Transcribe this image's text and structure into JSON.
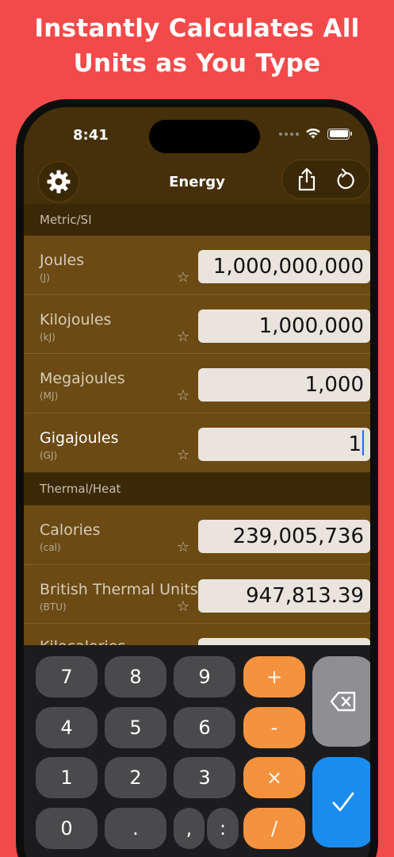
{
  "promo": {
    "line1": "Instantly Calculates All",
    "line2": "Units as You Type"
  },
  "status": {
    "time": "8:41"
  },
  "nav": {
    "title": "Energy",
    "icons": [
      "gear-icon",
      "share-icon",
      "reset-icon"
    ]
  },
  "sections": [
    {
      "title": "Metric/SI",
      "rows": [
        {
          "name": "Joules",
          "abbr": "(J)",
          "value": "1,000,000,000"
        },
        {
          "name": "Kilojoules",
          "abbr": "(kJ)",
          "value": "1,000,000"
        },
        {
          "name": "Megajoules",
          "abbr": "(MJ)",
          "value": "1,000"
        },
        {
          "name": "Gigajoules",
          "abbr": "(GJ)",
          "value": "1"
        }
      ]
    },
    {
      "title": "Thermal/Heat",
      "rows": [
        {
          "name": "Calories",
          "abbr": "(cal)",
          "value": "239,005,736"
        },
        {
          "name": "British Thermal Units",
          "abbr": "(BTU)",
          "value": "947,813.39"
        },
        {
          "name": "Kilocalories",
          "abbr": "",
          "value": ""
        }
      ]
    }
  ],
  "star_glyph": "☆",
  "keypad": {
    "keys": [
      "7",
      "8",
      "9",
      "+",
      "4",
      "5",
      "6",
      "-",
      "1",
      "2",
      "3",
      "×",
      "0",
      ".",
      ",",
      ":",
      "/"
    ],
    "icons": [
      "backspace-icon",
      "checkmark-icon"
    ]
  },
  "colors": {
    "background": "#f24a4a",
    "operator": "#f5923d",
    "confirm": "#1a8cf0",
    "rows": "#6b4a14"
  }
}
